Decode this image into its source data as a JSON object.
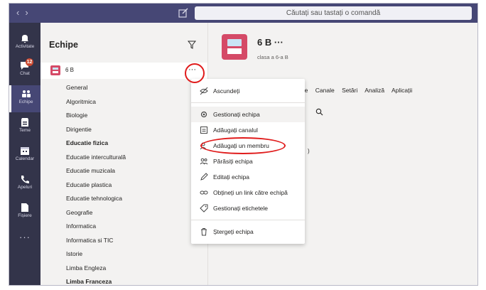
{
  "topbar": {
    "back_icon": "chevron-left-icon",
    "forward_icon": "chevron-right-icon",
    "compose_icon": "compose-icon",
    "search_placeholder": "Căutați sau tastați o comandă"
  },
  "rail": {
    "items": [
      {
        "label": "Activitate",
        "icon": "bell-icon"
      },
      {
        "label": "Chat",
        "icon": "chat-icon",
        "badge": "12"
      },
      {
        "label": "Echipe",
        "icon": "teams-icon",
        "active": true
      },
      {
        "label": "Teme",
        "icon": "assignments-icon"
      },
      {
        "label": "Calendar",
        "icon": "calendar-icon"
      },
      {
        "label": "Apeluri",
        "icon": "phone-icon"
      },
      {
        "label": "Fișiere",
        "icon": "files-icon"
      }
    ],
    "more": "···"
  },
  "teams": {
    "title": "Echipe",
    "team": {
      "name": "6 B",
      "more": "···"
    },
    "channels": [
      {
        "name": "General",
        "bold": false
      },
      {
        "name": "Algoritmica",
        "bold": false
      },
      {
        "name": "Biologie",
        "bold": false
      },
      {
        "name": "Dirigentie",
        "bold": false
      },
      {
        "name": "Educatie fizica",
        "bold": true
      },
      {
        "name": "Educatie interculturală",
        "bold": false
      },
      {
        "name": "Educatie muzicala",
        "bold": false
      },
      {
        "name": "Educatie plastica",
        "bold": false
      },
      {
        "name": "Educatie tehnologica",
        "bold": false
      },
      {
        "name": "Geografie",
        "bold": false
      },
      {
        "name": "Informatica",
        "bold": false
      },
      {
        "name": "Informatica si TIC",
        "bold": false
      },
      {
        "name": "Istorie",
        "bold": false
      },
      {
        "name": "Limba Engleza",
        "bold": false
      },
      {
        "name": "Limba Franceza",
        "bold": true
      }
    ]
  },
  "main": {
    "title": "6 B ···",
    "subtitle": "clasa a 6-a B",
    "tabs": [
      "ptare",
      "Canale",
      "Setări",
      "Analiză",
      "Aplicații"
    ],
    "partial_text": ")"
  },
  "menu": {
    "items": [
      {
        "label": "Ascundeți",
        "icon": "hide-icon"
      },
      {
        "label": "Gestionați echipa",
        "icon": "gear-icon"
      },
      {
        "label": "Adăugați canalul",
        "icon": "add-channel-icon"
      },
      {
        "label": "Adăugați un membru",
        "icon": "add-member-icon"
      },
      {
        "label": "Părăsiți echipa",
        "icon": "leave-icon"
      },
      {
        "label": "Editați echipa",
        "icon": "pencil-icon"
      },
      {
        "label": "Obțineți un link către echipă",
        "icon": "link-icon"
      },
      {
        "label": "Gestionați etichetele",
        "icon": "tag-icon"
      },
      {
        "label": "Ștergeți echipa",
        "icon": "trash-icon"
      }
    ]
  },
  "colors": {
    "topbar": "#464775",
    "rail": "#33344a",
    "avatar": "#d54a67",
    "highlight_circle": "#e01b1b"
  }
}
